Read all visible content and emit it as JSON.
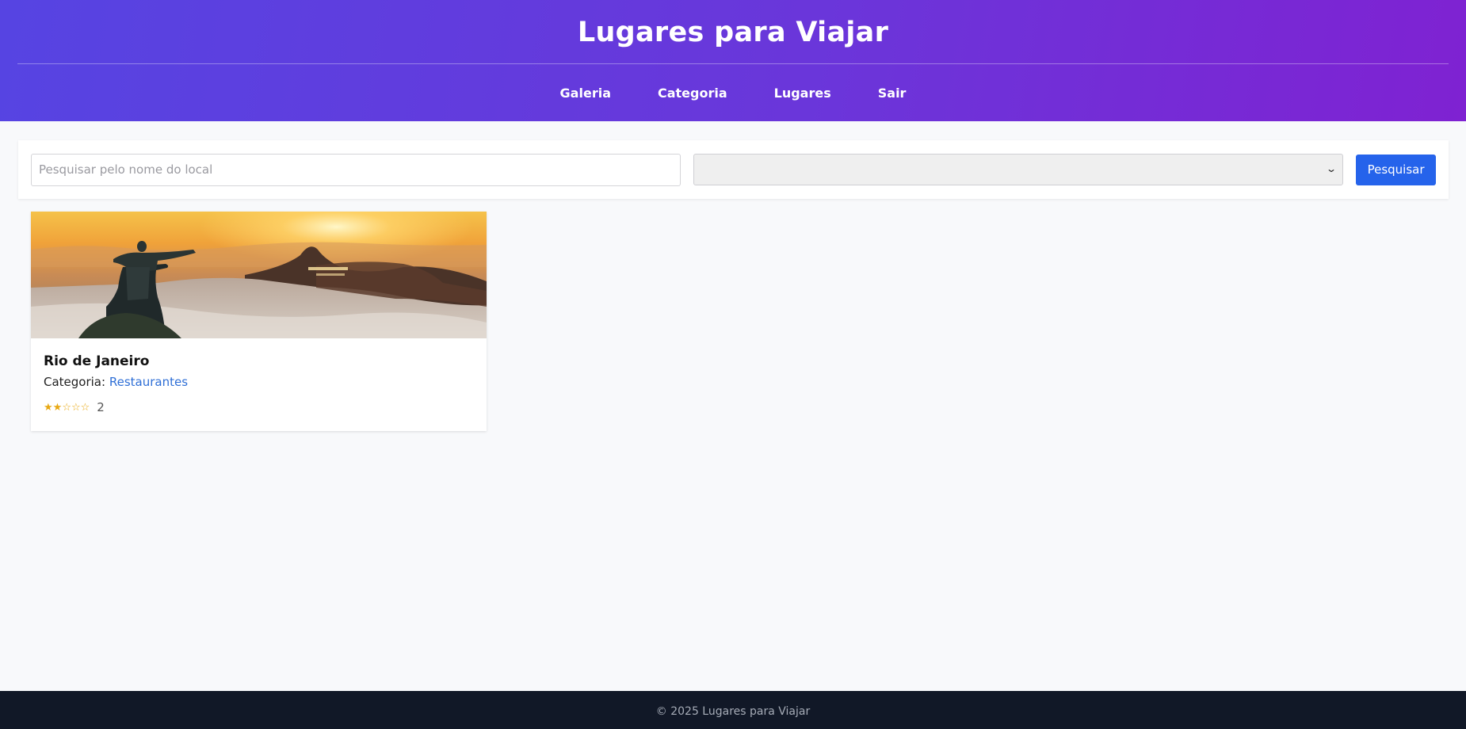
{
  "header": {
    "title": "Lugares para Viajar",
    "nav": [
      {
        "label": "Galeria"
      },
      {
        "label": "Categoria"
      },
      {
        "label": "Lugares"
      },
      {
        "label": "Sair"
      }
    ]
  },
  "search": {
    "placeholder": "Pesquisar pelo nome do local",
    "value": "",
    "category_selected": "",
    "button_label": "Pesquisar"
  },
  "places": [
    {
      "name": "Rio de Janeiro",
      "category_label": "Categoria:",
      "category": "Restaurantes",
      "rating": 2,
      "rating_max": 5,
      "rating_text": "2",
      "image": "rio-de-janeiro-photo"
    }
  ],
  "footer": {
    "text": "© 2025 Lugares para Viajar"
  },
  "colors": {
    "header_gradient_start": "#5644e2",
    "header_gradient_end": "#7f22d2",
    "button": "#2563eb",
    "link": "#2f6fd6",
    "star": "#e8a812",
    "footer_bg": "#111827"
  }
}
